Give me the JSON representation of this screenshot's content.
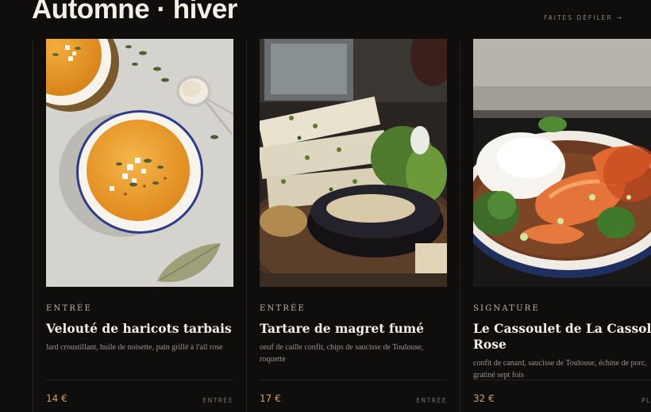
{
  "header": {
    "title": "Automne · hiver",
    "scroll_hint": "FAITES DÉFILER",
    "scroll_arrow": "→"
  },
  "dishes": [
    {
      "category": "ENTRÉE",
      "name": "Velouté de haricots tarbais",
      "description": "lard croustillant, huile de noisette, pain grillé à l'ail rose",
      "price": "14 €",
      "tag": "ENTRÉE",
      "photo": "pumpkin-soup-photo"
    },
    {
      "category": "ENTRÉE",
      "name": "Tartare de magret fumé",
      "description": "oeuf de caille confit, chips de saucisse de Toulouse, roquette",
      "price": "17 €",
      "tag": "ENTRÉE",
      "photo": "grilled-fish-with-sauce-photo"
    },
    {
      "category": "SIGNATURE",
      "name": "Le Cassoulet de La Cassole Rose",
      "description": "confit de canard, saucisse de Toulouse, échine de porc, gratiné sept fois",
      "price": "32 €",
      "tag": "PLAT",
      "photo": "shrimp-rice-stew-photo"
    }
  ],
  "colors": {
    "background": "#0f0e0d",
    "price": "#d3a253",
    "text": "#f4efe6",
    "muted": "#9b948a"
  }
}
